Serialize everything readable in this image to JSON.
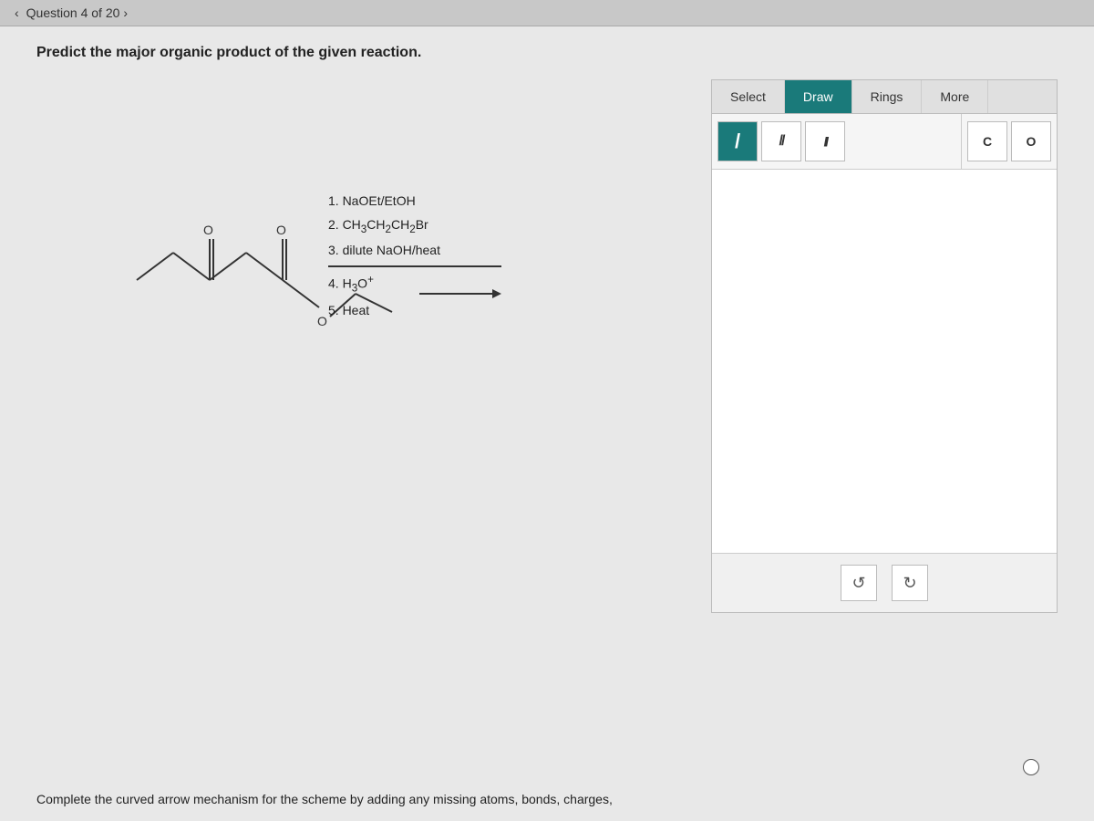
{
  "page": {
    "question_header": "Question 4 of 20",
    "question_text": "Predict the major organic product of the given reaction.",
    "bottom_text": "Complete the curved arrow mechanism for the scheme by adding any missing atoms, bonds, charges,"
  },
  "toolbar": {
    "tabs": [
      {
        "label": "Select",
        "active": false
      },
      {
        "label": "Draw",
        "active": true
      },
      {
        "label": "Rings",
        "active": false
      },
      {
        "label": "More",
        "active": false
      }
    ],
    "bonds": [
      {
        "label": "/",
        "title": "single bond",
        "active": true
      },
      {
        "label": "//",
        "title": "double bond",
        "active": false
      },
      {
        "label": "///",
        "title": "triple bond",
        "active": false
      }
    ],
    "atoms": [
      {
        "label": "C",
        "active": false
      },
      {
        "label": "O",
        "active": false
      }
    ],
    "undo_label": "↺",
    "redo_label": "↻"
  },
  "reaction": {
    "steps": [
      "1. NaOEt/EtOH",
      "2. CH₃CH₂CH₂Br",
      "3. dilute NaOH/heat",
      "4. H₃O⁺",
      "5. Heat"
    ]
  }
}
